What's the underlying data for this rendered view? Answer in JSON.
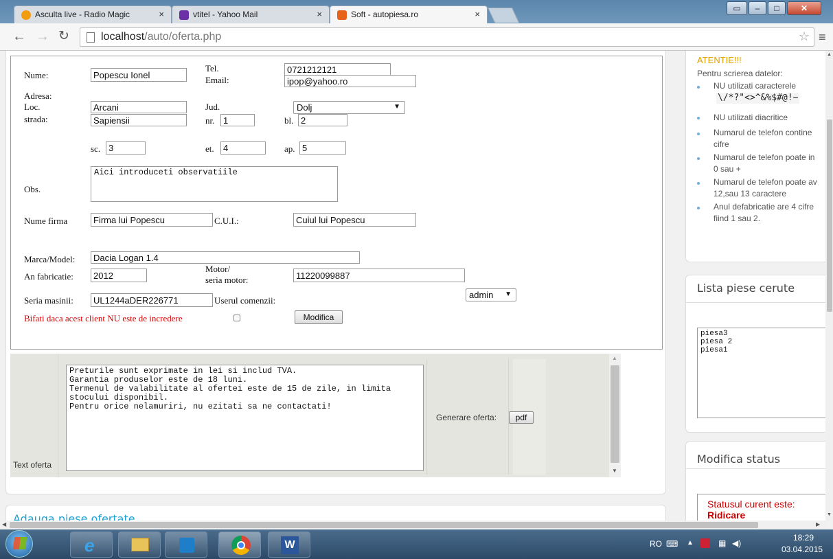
{
  "browser": {
    "tabs": [
      {
        "title": "Asculta live - Radio Magic",
        "fav_color": "#f39c12"
      },
      {
        "title": "vtitel - Yahoo Mail",
        "fav_color": "#6b2fa8"
      },
      {
        "title": "Soft - autopiesa.ro",
        "fav_color": "#e8631a"
      }
    ],
    "url_host": "localhost",
    "url_path": "/auto/oferta.php"
  },
  "form": {
    "nume_label": "Nume:",
    "nume_value": "Popescu Ionel",
    "tel_label": "Tel.",
    "tel_value": "0721212121",
    "email_label": "Email:",
    "email_value": "ipop@yahoo.ro",
    "adresa_label": "Adresa:",
    "loc_label": "Loc.",
    "loc_value": "Arcani",
    "jud_label": "Jud.",
    "jud_value": "Dolj",
    "strada_label": "strada:",
    "strada_value": "Sapiensii",
    "nr_label": "nr.",
    "nr_value": "1",
    "bl_label": "bl.",
    "bl_value": "2",
    "sc_label": "sc.",
    "sc_value": "3",
    "et_label": "et.",
    "et_value": "4",
    "ap_label": "ap.",
    "ap_value": "5",
    "obs_label": "Obs.",
    "obs_value": "Aici introduceti observatiile",
    "firma_label": "Nume firma",
    "firma_value": "Firma lui Popescu",
    "cui_label": "C.U.I.:",
    "cui_value": "Cuiul lui Popescu",
    "marca_label": "Marca/Model:",
    "marca_value": "Dacia Logan 1.4",
    "an_label": "An fabricatie:",
    "an_value": "2012",
    "motor_label_1": "Motor/",
    "motor_label_2": "seria motor:",
    "motor_value": "11220099887",
    "seria_label": "Seria masinii:",
    "seria_value": "UL1244aDER226771",
    "user_label": "Userul comenzii:",
    "user_value": "admin",
    "incredere_label": "Bifati daca acest client NU este de incredere",
    "modifica_button": "Modifica"
  },
  "oferta": {
    "text_label": "Text oferta",
    "text_value": "Preturile sunt exprimate in lei si includ TVA.\nGarantia produselor este de 18 luni.\nTermenul de valabilitate al ofertei este de 15 de zile, in limita\nstocului disponibil.\nPentru orice nelamuriri, nu ezitati sa ne contactati!",
    "generare_label": "Generare oferta:",
    "pdf_button": "pdf"
  },
  "bottom_panel_title": "Adauga piese ofertate",
  "sidebar": {
    "atentie_title": "ATENTIE!!!",
    "atentie_intro": "Pentru scrierea datelor:",
    "rules": [
      "NU utilizati caracterele",
      "NU utilizati diacritice",
      "Numarul de telefon contine",
      "cifre",
      "Numarul de telefon poate in",
      "0 sau +",
      "Numarul de telefon poate av",
      "12,sau 13 caractere",
      "Anul defabricatie are 4 cifre",
      "fiind 1 sau 2."
    ],
    "forbidden_chars": "\\/*?\"<>^&%$#@!~",
    "lista_title": "Lista piese cerute",
    "lista_value": "piesa3\npiesa 2\npiesa1",
    "status_title": "Modifica status",
    "status_text": "Statusul curent este:",
    "status_value": "Ridicare",
    "status_color": "#cc0000"
  },
  "taskbar": {
    "lang": "RO",
    "time": "18:29",
    "date": "03.04.2015"
  }
}
